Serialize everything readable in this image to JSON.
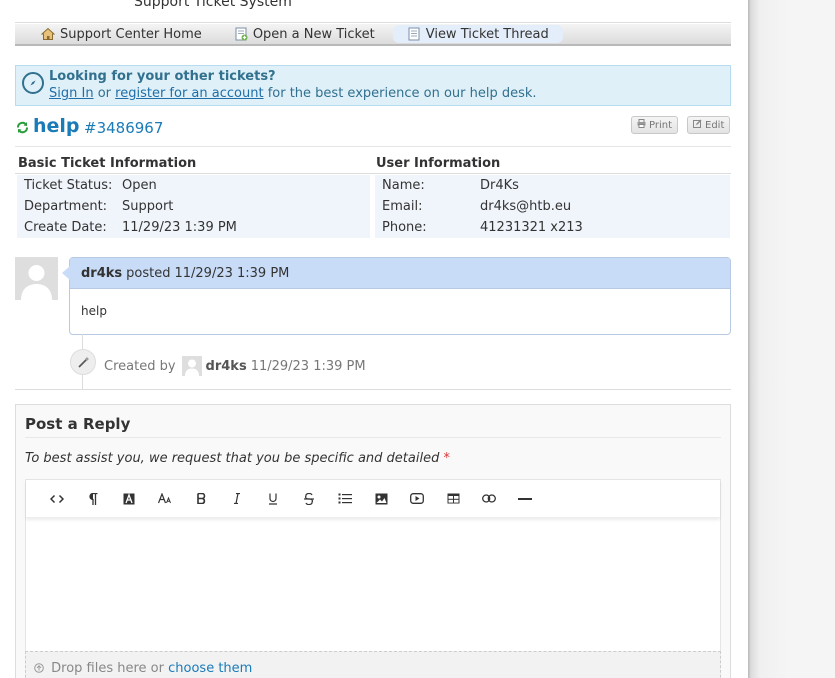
{
  "header": {
    "title": "Support Ticket System"
  },
  "nav": {
    "items": [
      {
        "label": "Support Center Home",
        "icon": "home-icon",
        "active": false
      },
      {
        "label": "Open a New Ticket",
        "icon": "new-ticket-icon",
        "active": false
      },
      {
        "label": "View Ticket Thread",
        "icon": "ticket-thread-icon",
        "active": true
      }
    ]
  },
  "notice": {
    "title": "Looking for your other tickets?",
    "sign_in": "Sign In",
    "or": "or",
    "register": "register for an account",
    "suffix": "for the best experience on our help desk."
  },
  "ticket": {
    "subject": "help",
    "number": "#3486967",
    "print_label": "Print",
    "edit_label": "Edit"
  },
  "basic_info": {
    "title": "Basic Ticket Information",
    "rows": [
      {
        "key": "Ticket Status:",
        "value": "Open"
      },
      {
        "key": "Department:",
        "value": "Support"
      },
      {
        "key": "Create Date:",
        "value": "11/29/23 1:39 PM"
      }
    ]
  },
  "user_info": {
    "title": "User Information",
    "rows": [
      {
        "key": "Name:",
        "value": "Dr4Ks"
      },
      {
        "key": "Email:",
        "value": "dr4ks@htb.eu"
      },
      {
        "key": "Phone:",
        "value": "41231321 x213"
      }
    ]
  },
  "thread": {
    "author": "dr4ks",
    "posted": "posted",
    "date": "11/29/23 1:39 PM",
    "body": "help"
  },
  "event": {
    "prefix": "Created by",
    "author": "dr4ks",
    "date": "11/29/23 1:39 PM"
  },
  "reply": {
    "title": "Post a Reply",
    "hint": "To best assist you, we request that you be specific and detailed",
    "required_mark": "*",
    "toolbar": [
      "code",
      "paragraph",
      "font-color",
      "font-size",
      "bold",
      "italic",
      "underline",
      "strikethrough",
      "list",
      "image",
      "video",
      "table",
      "link",
      "horizontal-rule"
    ],
    "drop_text": "Drop files here or",
    "choose_label": "choose them"
  },
  "colors": {
    "link": "#1a7bb9",
    "notice_bg": "#dff0f8",
    "thread_header": "#c9dcf7"
  }
}
